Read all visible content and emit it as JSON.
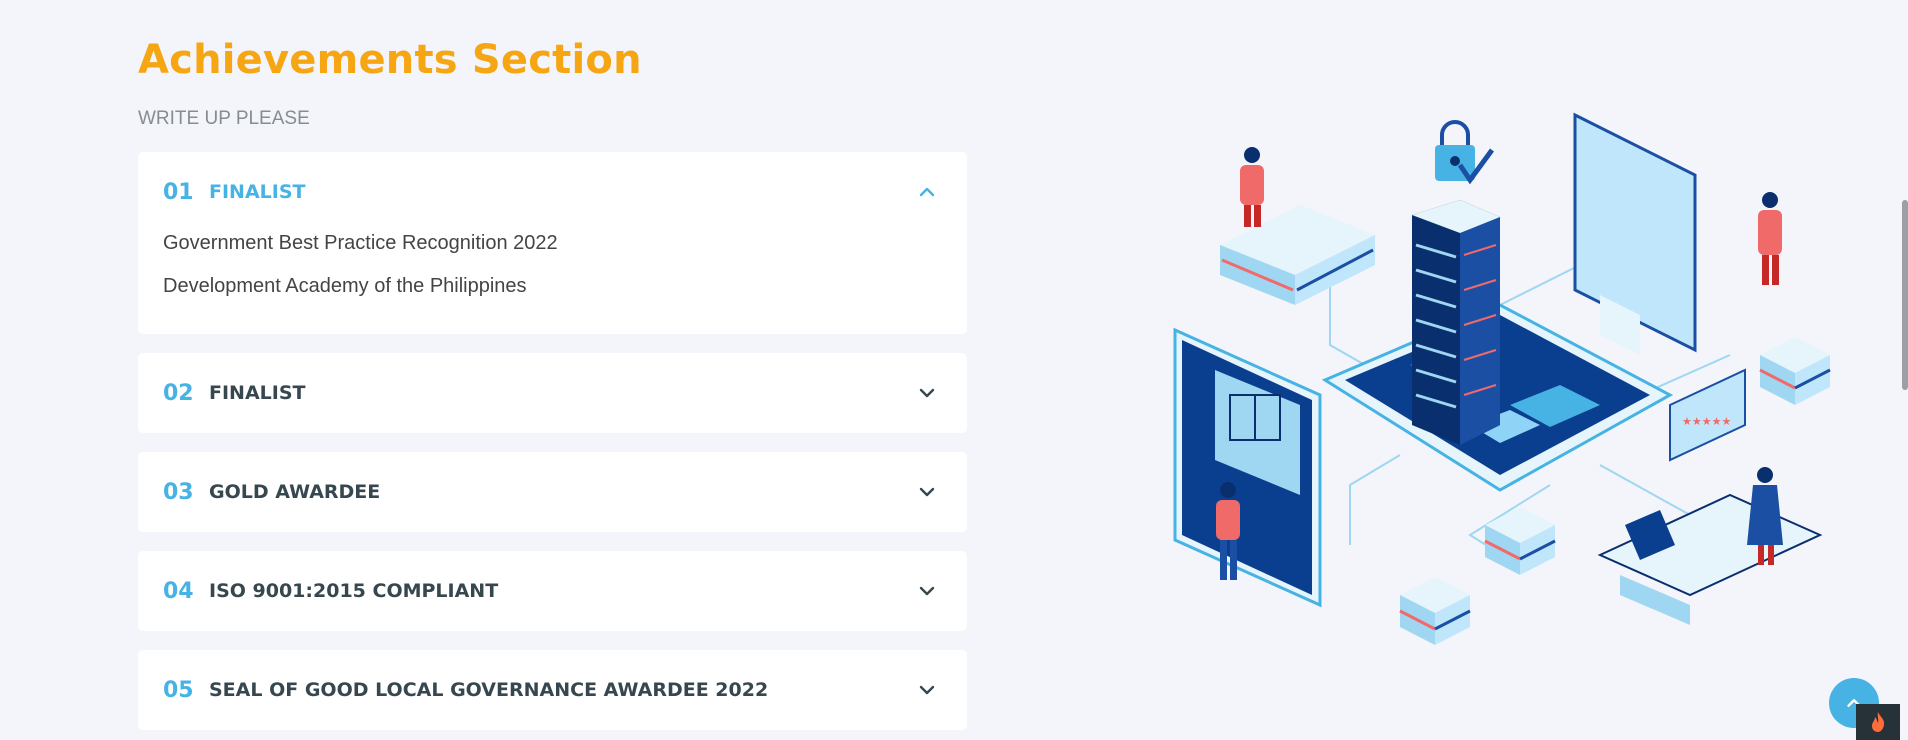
{
  "section": {
    "title": "Achievements Section",
    "subtitle": "WRITE UP PLEASE"
  },
  "faq": [
    {
      "num": "01",
      "title": "FINALIST",
      "open": true,
      "lines": [
        "Government Best Practice Recognition 2022",
        "Development Academy of the Philippines"
      ]
    },
    {
      "num": "02",
      "title": "FINALIST",
      "open": false
    },
    {
      "num": "03",
      "title": "GOLD AWARDEE",
      "open": false
    },
    {
      "num": "04",
      "title": "ISO 9001:2015 COMPLIANT",
      "open": false
    },
    {
      "num": "05",
      "title": "SEAL OF GOOD LOCAL GOVERNANCE AWARDEE 2022",
      "open": false
    }
  ],
  "colors": {
    "accent": "#47b2e4",
    "title": "#f7a613",
    "background": "#f3f5fa"
  },
  "icons": {
    "expanded": "chevron-up-icon",
    "collapsed": "chevron-down-icon",
    "back_to_top": "arrow-up-icon",
    "corner": "flame-icon"
  }
}
